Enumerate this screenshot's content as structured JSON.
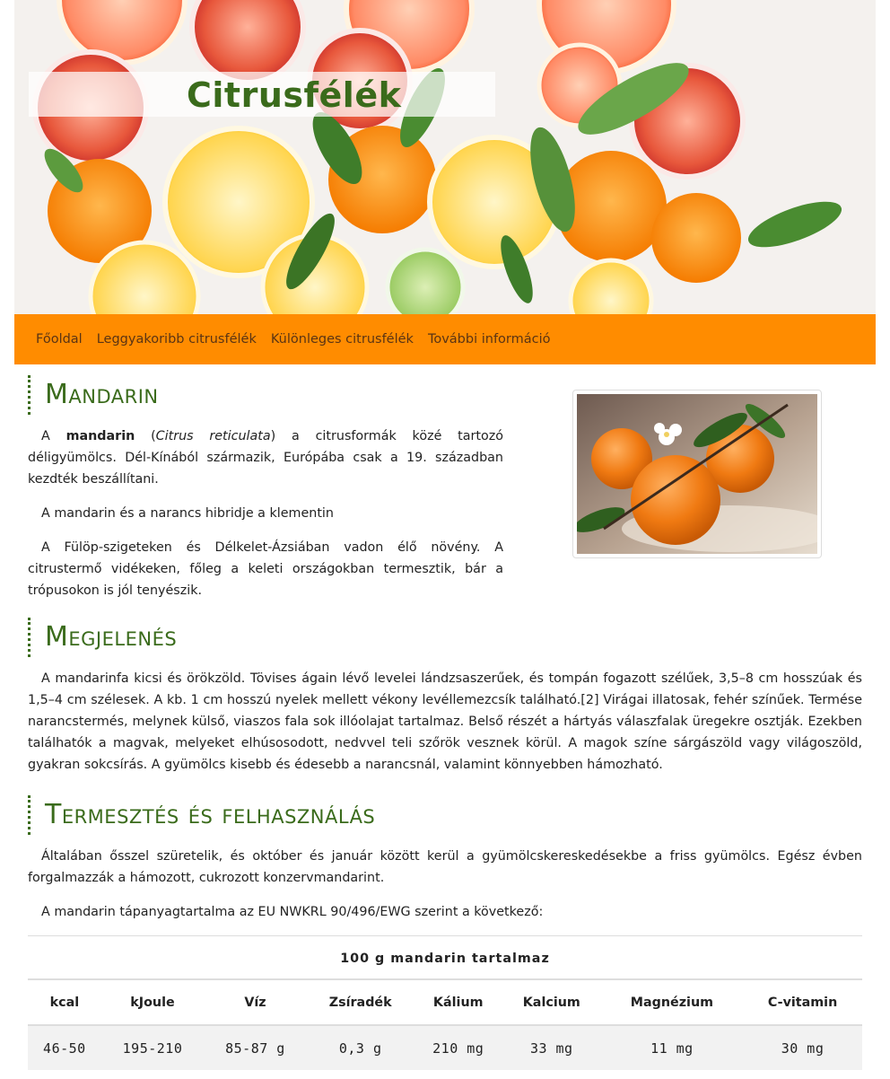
{
  "site": {
    "title": "Citrusfélék"
  },
  "nav": {
    "items": [
      {
        "label": "Főoldal"
      },
      {
        "label": "Leggyakoribb citrusfélék"
      },
      {
        "label": "Különleges citrusfélék"
      },
      {
        "label": "További információ"
      }
    ]
  },
  "section1": {
    "heading": "Mandarin",
    "p1": {
      "pre": "A ",
      "bold": "mandarin",
      "mid": " (",
      "italic": "Citrus reticulata",
      "post": ") a citrusformák közé tartozó déligyümölcs. Dél-Kínából származik, Európába csak a 19. században kezdték beszállítani."
    },
    "p2": "A mandarin és a narancs hibridje a klementin",
    "p3": "A Fülöp-szigeteken és Délkelet-Ázsiában vadon élő növény. A citrustermő vidékeken, főleg a keleti országokban termesztik, bár a trópusokon is jól tenyészik."
  },
  "section2": {
    "heading": "Megjelenés",
    "p1": "A mandarinfa kicsi és örökzöld. Tövises ágain lévő levelei lándzsaszerűek, és tompán fogazott szélűek, 3,5–8 cm hosszúak és 1,5–4 cm szélesek. A kb. 1 cm hosszú nyelek mellett vékony levéllemezcsík található.[2] Virágai illatosak, fehér színűek. Termése narancstermés, melynek külső, viaszos fala sok illóolajat tartalmaz. Belső részét a hártyás válaszfalak üregekre osztják. Ezekben találhatók a magvak, melyeket elhúsosodott, nedvvel teli szőrök vesznek körül. A magok színe sárgászöld vagy világoszöld, gyakran sokcsírás. A gyümölcs kisebb és édesebb a narancsnál, valamint könnyebben hámozható."
  },
  "section3": {
    "heading": "Termesztés és felhasználás",
    "p1": "Általában ősszel szüretelik, és október és január között kerül a gyümölcskereskedésekbe a friss gyümölcs. Egész évben forgalmazzák a hámozott, cukrozott konzervmandarint.",
    "p2": "A mandarin tápanyagtartalma az EU NWKRL 90/496/EWG szerint a következő:"
  },
  "table": {
    "caption": "100 g mandarin tartalmaz",
    "headers": [
      "kcal",
      "kJoule",
      "Víz",
      "Zsíradék",
      "Kálium",
      "Kalcium",
      "Magnézium",
      "C-vitamin"
    ],
    "row": [
      "46-50",
      "195-210",
      "85-87 g",
      "0,3 g",
      "210 mg",
      "33 mg",
      "11 mg",
      "30 mg"
    ]
  },
  "colors": {
    "accent_green": "#3a6b1b",
    "nav_orange": "#ff8c00",
    "nav_text": "#5a3414"
  },
  "icons": {
    "hero": "citrus-slices-image",
    "photo": "mandarin-photo"
  }
}
